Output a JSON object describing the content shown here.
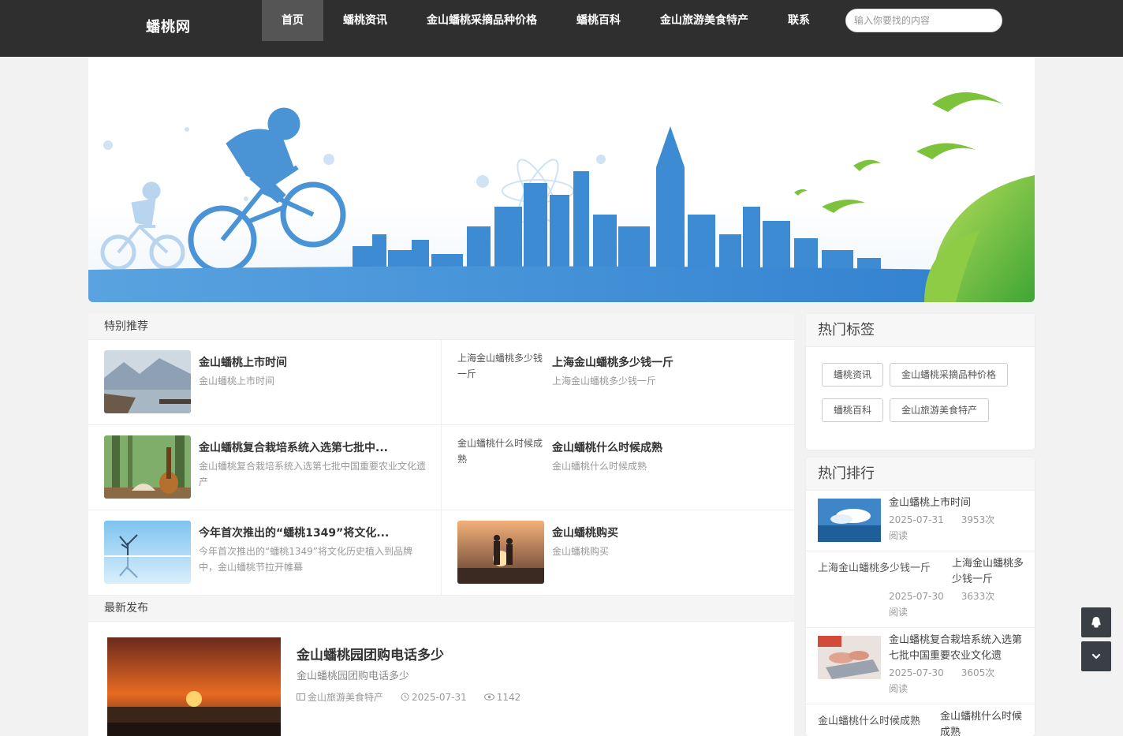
{
  "site": {
    "logo": "蟠桃网"
  },
  "nav": [
    {
      "label": "首页",
      "active": true
    },
    {
      "label": "蟠桃资讯"
    },
    {
      "label": "金山蟠桃采摘品种价格"
    },
    {
      "label": "蟠桃百科"
    },
    {
      "label": "金山旅游美食特产"
    },
    {
      "label": "联系"
    }
  ],
  "search": {
    "placeholder": "输入你要找的内容"
  },
  "featured": {
    "heading": "特别推荐",
    "items": [
      {
        "title": "金山蟠桃上市时间",
        "desc": "金山蟠桃上市时间",
        "thumb": "landscape-lake"
      },
      {
        "title": "上海金山蟠桃多少钱一斤",
        "desc": "上海金山蟠桃多少钱一斤",
        "thumb_alt": "上海金山蟠桃多少钱一斤"
      },
      {
        "title": "金山蟠桃复合栽培系统入选第七批中...",
        "desc": "金山蟠桃复合栽培系统入选第七批中国重要农业文化遗产",
        "thumb": "guitar-forest"
      },
      {
        "title": "金山蟠桃什么时候成熟",
        "desc": "金山蟠桃什么时候成熟",
        "thumb_alt": "金山蟠桃什么时候成熟"
      },
      {
        "title": "今年首次推出的“蟠桃1349”将文化...",
        "desc": "今年首次推出的“蟠桃1349”将文化历史植入到品牌中，金山蟠桃节拉开帷幕",
        "thumb": "tree-reflection"
      },
      {
        "title": "金山蟠桃购买",
        "desc": "金山蟠桃购买",
        "thumb": "couple-sunset"
      }
    ]
  },
  "latest": {
    "heading": "最新发布",
    "items": [
      {
        "title": "金山蟠桃园团购电话多少",
        "desc": "金山蟠桃园团购电话多少",
        "category": "金山旅游美食特产",
        "date": "2025-07-31",
        "views": "1142"
      }
    ]
  },
  "hot_tags": {
    "heading": "热门标签",
    "tags": [
      "蟠桃资讯",
      "金山蟠桃采摘品种价格",
      "蟠桃百科",
      "金山旅游美食特产"
    ]
  },
  "hot_rank": {
    "heading": "热门排行",
    "items": [
      {
        "title": "金山蟠桃上市时间",
        "date": "2025-07-31",
        "views": "3953次阅读",
        "thumb": "sea-clouds"
      },
      {
        "title": "上海金山蟠桃多少钱一斤",
        "thumb_alt": "上海金山蟠桃多少钱一斤",
        "date": "2025-07-30",
        "views": "3633次阅读"
      },
      {
        "title": "金山蟠桃复合栽培系统入选第七批中国重要农业文化遗",
        "date": "2025-07-30",
        "views": "3605次阅读",
        "thumb": "typing-laptop"
      },
      {
        "title": "金山蟠桃什么时候成熟",
        "thumb_alt": "金山蟠桃什么时候成熟"
      }
    ]
  },
  "colors": {
    "header_bg": "#2f2f2f",
    "nav_active": "#555555",
    "accent_blue": "#3a8fd6",
    "float_btn": "#3a3f45"
  },
  "icons": {
    "qq": "qq-penguin-icon",
    "scroll": "chevron-down-icon",
    "category": "folder-icon",
    "time": "clock-icon",
    "views": "eye-icon"
  }
}
